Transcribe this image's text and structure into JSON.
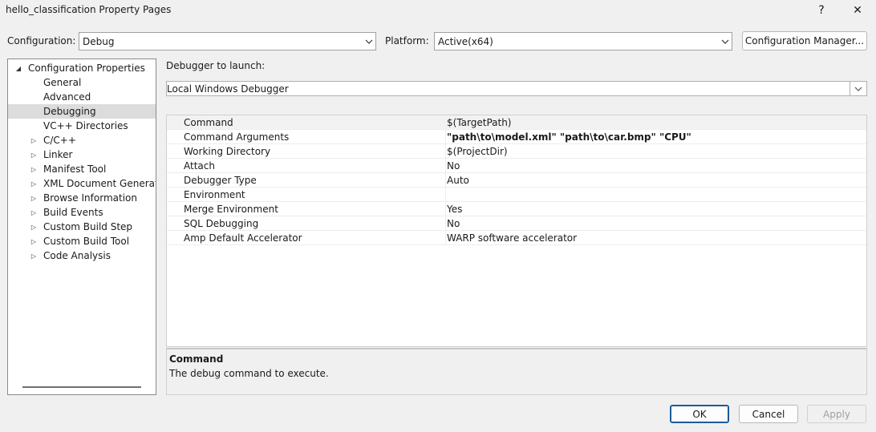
{
  "window": {
    "title": "hello_classification Property Pages",
    "help_label": "?",
    "close_label": "✕"
  },
  "toolbar": {
    "configuration_label": "Configuration:",
    "configuration_value": "Debug",
    "platform_label": "Platform:",
    "platform_value": "Active(x64)",
    "config_manager_label": "Configuration Manager..."
  },
  "tree": {
    "root": "Configuration Properties",
    "items": [
      {
        "label": "General",
        "expandable": false,
        "selected": false
      },
      {
        "label": "Advanced",
        "expandable": false,
        "selected": false
      },
      {
        "label": "Debugging",
        "expandable": false,
        "selected": true
      },
      {
        "label": "VC++ Directories",
        "expandable": false,
        "selected": false
      },
      {
        "label": "C/C++",
        "expandable": true,
        "selected": false
      },
      {
        "label": "Linker",
        "expandable": true,
        "selected": false
      },
      {
        "label": "Manifest Tool",
        "expandable": true,
        "selected": false
      },
      {
        "label": "XML Document Generator",
        "expandable": true,
        "selected": false
      },
      {
        "label": "Browse Information",
        "expandable": true,
        "selected": false
      },
      {
        "label": "Build Events",
        "expandable": true,
        "selected": false
      },
      {
        "label": "Custom Build Step",
        "expandable": true,
        "selected": false
      },
      {
        "label": "Custom Build Tool",
        "expandable": true,
        "selected": false
      },
      {
        "label": "Code Analysis",
        "expandable": true,
        "selected": false
      }
    ]
  },
  "debugger": {
    "launch_label": "Debugger to launch:",
    "launch_value": "Local Windows Debugger"
  },
  "properties": [
    {
      "name": "Command",
      "value": "$(TargetPath)",
      "bold": false
    },
    {
      "name": "Command Arguments",
      "value": "\"path\\to\\model.xml\" \"path\\to\\car.bmp\" \"CPU\"",
      "bold": true
    },
    {
      "name": "Working Directory",
      "value": "$(ProjectDir)",
      "bold": false
    },
    {
      "name": "Attach",
      "value": "No",
      "bold": false
    },
    {
      "name": "Debugger Type",
      "value": "Auto",
      "bold": false
    },
    {
      "name": "Environment",
      "value": "",
      "bold": false
    },
    {
      "name": "Merge Environment",
      "value": "Yes",
      "bold": false
    },
    {
      "name": "SQL Debugging",
      "value": "No",
      "bold": false
    },
    {
      "name": "Amp Default Accelerator",
      "value": "WARP software accelerator",
      "bold": false
    }
  ],
  "description": {
    "title": "Command",
    "text": "The debug command to execute."
  },
  "buttons": {
    "ok": "OK",
    "cancel": "Cancel",
    "apply": "Apply"
  }
}
